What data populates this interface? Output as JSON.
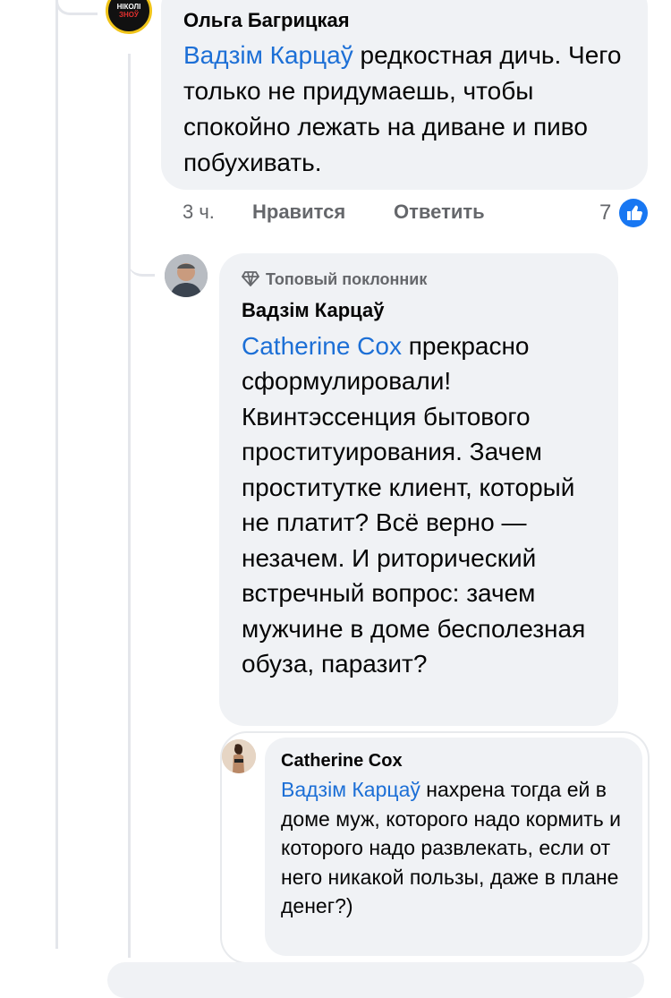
{
  "comments": [
    {
      "author": "Ольга Багрицкая",
      "avatar_text_top": "НІКОЛІ",
      "avatar_text_bottom": "ЗНОЎ",
      "mention": "Вадзім Карцаў",
      "text": " редкостная дичь. Чего только не придумаешь, чтобы спокойно лежать на диване и пиво побухивать.",
      "time": "3 ч.",
      "like_label": "Нравится",
      "reply_label": "Ответить",
      "reaction_count": "7"
    },
    {
      "badge": "Топовый поклонник",
      "author": "Вадзім Карцаў",
      "mention": "Catherine Cox",
      "text": " прекрасно сформулировали! Квинтэссенция бытового проституирования. Зачем проститутке клиент, который не платит? Всё верно — незачем. И риторический встречный вопрос: зачем мужчине в доме бесполезная обуза, паразит?"
    },
    {
      "author": "Catherine Cox",
      "mention": "Вадзім Карцаў",
      "text": " нахрена тогда ей в доме муж, которого надо кормить и которого надо развлекать, если от него никакой пользы, даже в плане денег?)"
    }
  ],
  "colors": {
    "accent": "#1c6fd6",
    "bubble": "#f0f2f5",
    "meta": "#65676b",
    "like": "#1877f2"
  }
}
